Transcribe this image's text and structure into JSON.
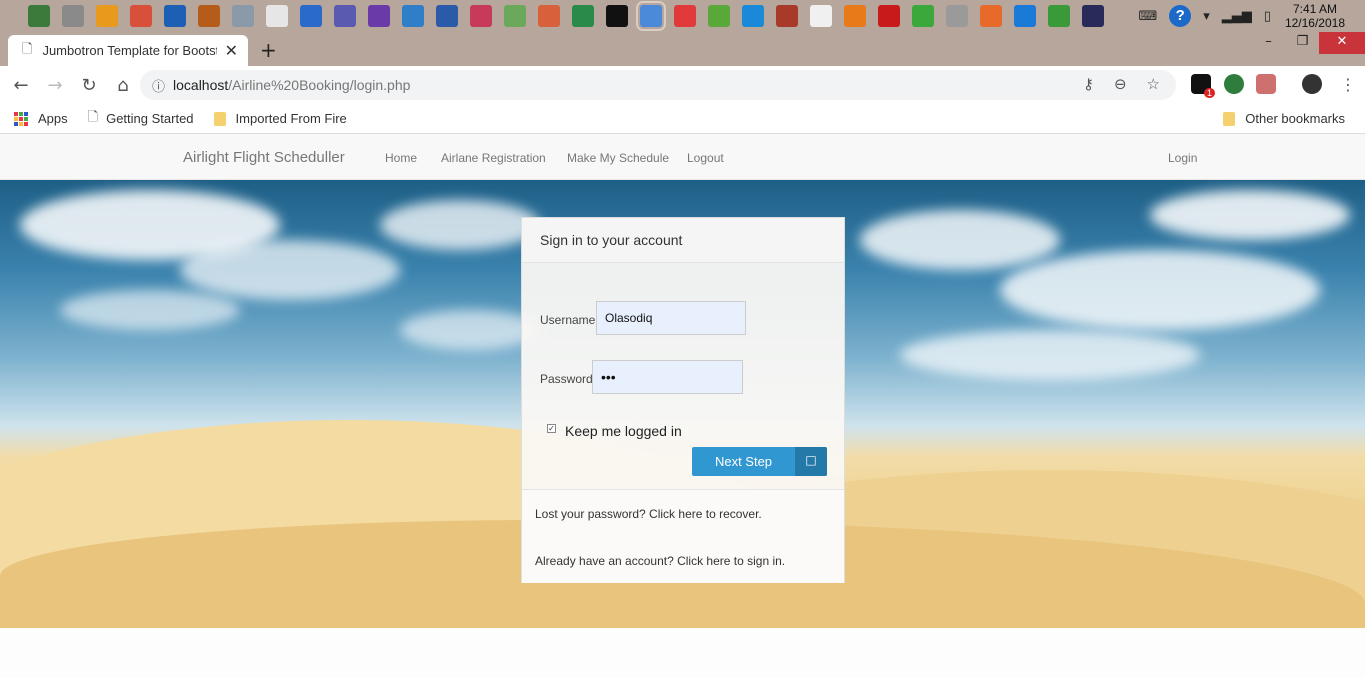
{
  "taskbar": {
    "icon_colors": [
      "#3c7a3c",
      "#8a8a8a",
      "#e89a1c",
      "#d8503a",
      "#1d5fb5",
      "#b55c1a",
      "#8a9aa8",
      "#e6e6e6",
      "#2a6ac8",
      "#5a5ab0",
      "#6a3aa8",
      "#2f7fc8",
      "#2a5aa8",
      "#c83a5a",
      "#6aa85a",
      "#d8603a",
      "#2a8a4a",
      "#111111",
      "#4a8ad8",
      "#e23a3a",
      "#5aa83a",
      "#1a8ad8",
      "#a83a2a",
      "#f0f0f0",
      "#e87a1a",
      "#c81a1a",
      "#3aa83a",
      "#9a9a9a",
      "#e86a2a",
      "#1a7ad8",
      "#3a9a3a",
      "#2a2a5a"
    ],
    "clock_time": "7:41 AM",
    "clock_date": "12/16/2018"
  },
  "browser": {
    "tab_title": "Jumbotron Template for Bootstrap",
    "url_host": "localhost",
    "url_path": "/Airline%20Booking/login.php",
    "extension_badge": "1",
    "bookmarks": [
      {
        "label": "Apps",
        "icon": "apps-grid-icon"
      },
      {
        "label": "Getting Started",
        "icon": "page-icon"
      },
      {
        "label": "Imported From Fire",
        "icon": "folder-icon"
      }
    ],
    "other_bookmarks": "Other bookmarks"
  },
  "navbar": {
    "brand": "Airlight Flight Scheduller",
    "links": [
      "Home",
      "Airlane Registration",
      "Make My Schedule",
      "Logout"
    ],
    "login": "Login"
  },
  "login": {
    "heading": "Sign in to your account",
    "username_label": "Username:",
    "username_value": "Olasodiq",
    "password_label": "Password:",
    "password_value": "•••",
    "keep_logged": "Keep me logged in",
    "keep_checked": true,
    "submit": "Next Step",
    "lost_password": "Lost your password? Click here to recover.",
    "have_account": "Already have an account? Click here to sign in."
  }
}
